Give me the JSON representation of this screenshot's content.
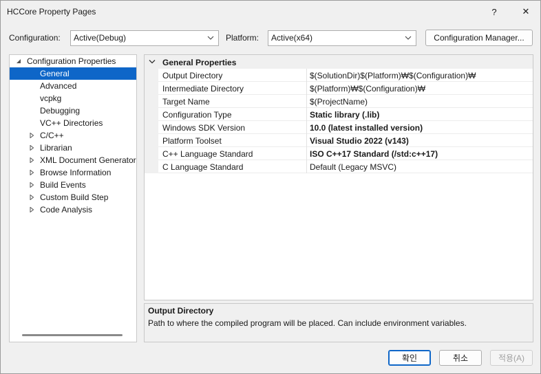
{
  "window": {
    "title": "HCCore Property Pages"
  },
  "titlebar": {
    "help_label": "?",
    "close_label": "✕"
  },
  "config": {
    "configuration_label": "Configuration:",
    "configuration_value": "Active(Debug)",
    "platform_label": "Platform:",
    "platform_value": "Active(x64)",
    "manager_button": "Configuration Manager..."
  },
  "tree": {
    "root": "Configuration Properties",
    "items": [
      {
        "label": "General",
        "expandable": false
      },
      {
        "label": "Advanced",
        "expandable": false
      },
      {
        "label": "vcpkg",
        "expandable": false
      },
      {
        "label": "Debugging",
        "expandable": false
      },
      {
        "label": "VC++ Directories",
        "expandable": false
      },
      {
        "label": "C/C++",
        "expandable": true
      },
      {
        "label": "Librarian",
        "expandable": true
      },
      {
        "label": "XML Document Generator",
        "expandable": true
      },
      {
        "label": "Browse Information",
        "expandable": true
      },
      {
        "label": "Build Events",
        "expandable": true
      },
      {
        "label": "Custom Build Step",
        "expandable": true
      },
      {
        "label": "Code Analysis",
        "expandable": true
      }
    ],
    "selected": "General"
  },
  "grid": {
    "section_title": "General Properties",
    "rows": [
      {
        "name": "Output Directory",
        "value": "$(SolutionDir)$(Platform)₩$(Configuration)₩",
        "bold": false
      },
      {
        "name": "Intermediate Directory",
        "value": "$(Platform)₩$(Configuration)₩",
        "bold": false
      },
      {
        "name": "Target Name",
        "value": "$(ProjectName)",
        "bold": false
      },
      {
        "name": "Configuration Type",
        "value": "Static library (.lib)",
        "bold": true
      },
      {
        "name": "Windows SDK Version",
        "value": "10.0 (latest installed version)",
        "bold": true
      },
      {
        "name": "Platform Toolset",
        "value": "Visual Studio 2022 (v143)",
        "bold": true
      },
      {
        "name": "C++ Language Standard",
        "value": "ISO C++17 Standard (/std:c++17)",
        "bold": true
      },
      {
        "name": "C Language Standard",
        "value": "Default (Legacy MSVC)",
        "bold": false
      }
    ]
  },
  "description": {
    "title": "Output Directory",
    "text": "Path to where the compiled program will be placed. Can include environment variables."
  },
  "buttons": {
    "ok": "확인",
    "cancel": "취소",
    "apply": "적용(A)"
  },
  "colors": {
    "selection": "#0e66c8",
    "background": "#f0f0f0"
  }
}
